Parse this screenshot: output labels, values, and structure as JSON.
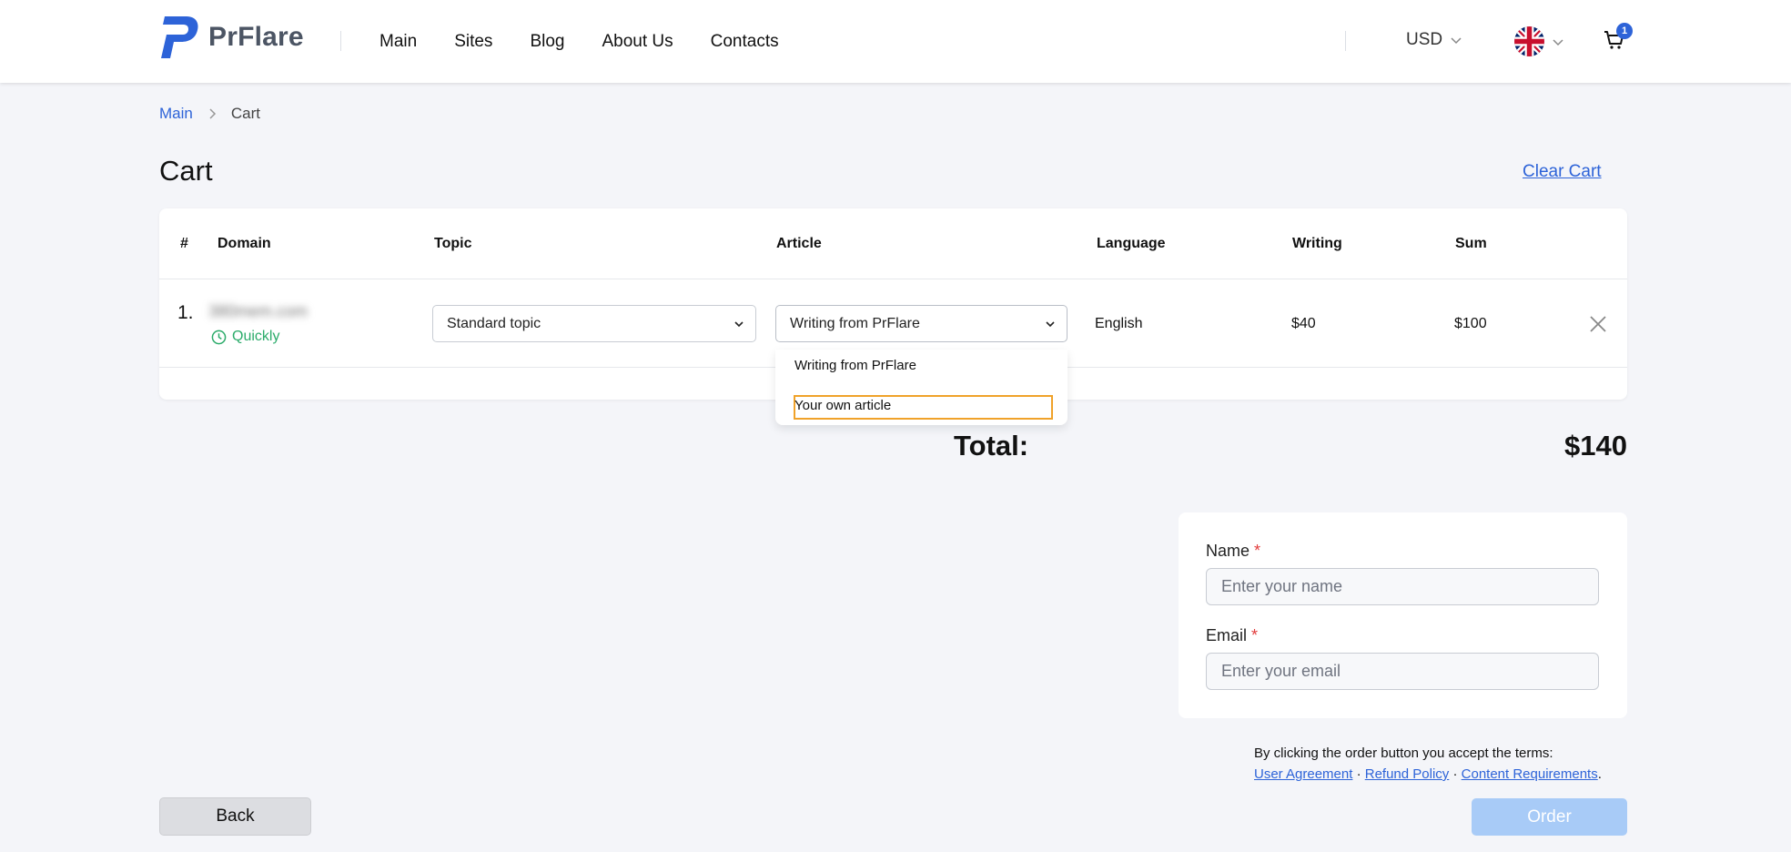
{
  "header": {
    "brand": "PrFlare",
    "nav": [
      "Main",
      "Sites",
      "Blog",
      "About Us",
      "Contacts"
    ],
    "currency": "USD",
    "cart_count": "1"
  },
  "breadcrumb": {
    "link": "Main",
    "current": "Cart"
  },
  "page": {
    "title": "Cart",
    "clear_cart": "Clear Cart"
  },
  "table": {
    "columns": {
      "num": "#",
      "domain": "Domain",
      "topic": "Topic",
      "article": "Article",
      "language": "Language",
      "writing": "Writing",
      "sum": "Sum"
    },
    "rows": [
      {
        "num": "1.",
        "domain": "380mem.com",
        "badge": "Quickly",
        "topic": "Standard topic",
        "article": "Writing from PrFlare",
        "language": "English",
        "writing": "$40",
        "sum": "$100"
      }
    ]
  },
  "article_dropdown": {
    "options": [
      "Writing from PrFlare",
      "Your own article"
    ],
    "focused_index": 1
  },
  "total": {
    "label": "Total:",
    "value": "$140"
  },
  "form": {
    "name_label": "Name",
    "name_placeholder": "Enter your name",
    "email_label": "Email",
    "email_placeholder": "Enter your email",
    "required_mark": "*"
  },
  "terms": {
    "text": "By clicking the order button you accept the terms:",
    "links": [
      "User Agreement",
      "Refund Policy",
      "Content Requirements"
    ],
    "separator": "·",
    "end": "."
  },
  "buttons": {
    "back": "Back",
    "order": "Order"
  },
  "colors": {
    "accent": "#2d63d8",
    "success": "#2bab6a",
    "order_disabled": "#a8cbf7",
    "focus_outline": "#f0a22a"
  }
}
